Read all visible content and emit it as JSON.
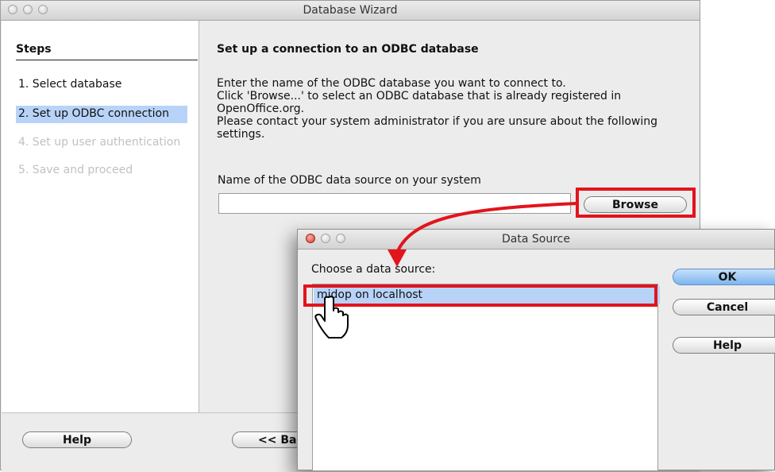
{
  "wizard": {
    "title": "Database Wizard",
    "steps_heading": "Steps",
    "steps": [
      {
        "label": "1. Select database",
        "state": "done"
      },
      {
        "label": "2. Set up ODBC connection",
        "state": "active"
      },
      {
        "label": "4. Set up user authentication",
        "state": "disabled"
      },
      {
        "label": "5. Save and proceed",
        "state": "disabled"
      }
    ],
    "heading": "Set up a connection to an ODBC database",
    "description": [
      "Enter the name of the ODBC database you want to connect to.",
      "Click 'Browse...' to select an ODBC database that is already registered in",
      "OpenOffice.org.",
      "Please contact your system administrator if you are unsure about the following",
      "settings."
    ],
    "field_label": "Name of the ODBC data source on your system",
    "field_value": "",
    "browse_label": "Browse",
    "help_label": "Help",
    "back_label": "<< Ba"
  },
  "data_source_dialog": {
    "title": "Data Source",
    "prompt": "Choose a data source:",
    "items": [
      "midop on localhost"
    ],
    "ok_label": "OK",
    "cancel_label": "Cancel",
    "help_label": "Help"
  },
  "colors": {
    "highlight": "#e2141c",
    "selection": "#b8d3f8",
    "default_button": "#7db5ee"
  }
}
